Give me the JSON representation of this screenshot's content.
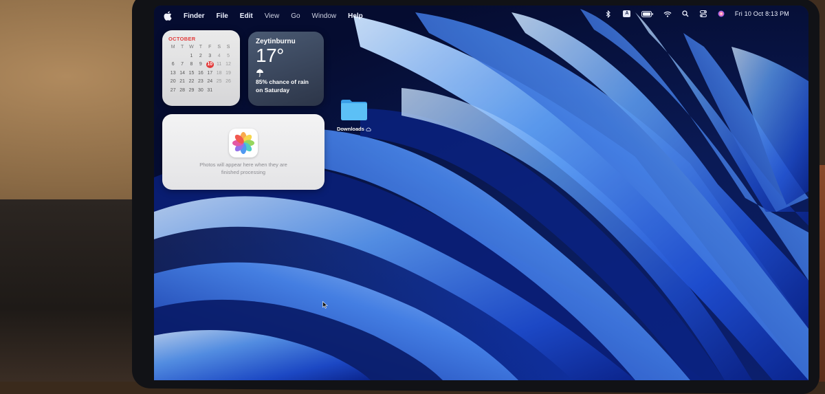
{
  "menubar": {
    "app_name": "Finder",
    "menus": [
      "File",
      "Edit",
      "View",
      "Go",
      "Window",
      "Help"
    ],
    "status_icons": [
      "bluetooth-icon",
      "input-source-icon",
      "battery-icon",
      "wifi-icon",
      "spotlight-search-icon",
      "control-center-icon",
      "siri-icon"
    ],
    "input_source": "A",
    "clock": "Fri 10 Oct  8:13 PM"
  },
  "calendar_widget": {
    "month": "OCTOBER",
    "weekdays": [
      "M",
      "T",
      "W",
      "T",
      "F",
      "S",
      "S"
    ],
    "weeks": [
      [
        "",
        "",
        "1",
        "2",
        "3",
        "4",
        "5"
      ],
      [
        "6",
        "7",
        "8",
        "9",
        "10",
        "11",
        "12"
      ],
      [
        "13",
        "14",
        "15",
        "16",
        "17",
        "18",
        "19"
      ],
      [
        "20",
        "21",
        "22",
        "23",
        "24",
        "25",
        "26"
      ],
      [
        "27",
        "28",
        "29",
        "30",
        "31",
        "",
        ""
      ]
    ],
    "today": "10",
    "accent_color": "#e23b3b"
  },
  "weather_widget": {
    "city": "Zeytinburnu",
    "temperature": "17°",
    "condition_icon": "umbrella-icon",
    "condition_line1": "85% chance of rain",
    "condition_line2": "on Saturday"
  },
  "photos_widget": {
    "icon": "photos-app-icon",
    "message_line1": "Photos will appear here when they are",
    "message_line2": "finished processing"
  },
  "desktop_items": [
    {
      "label": "Downloads",
      "icon": "folder-icon",
      "cloud_status": "icloud-icon"
    }
  ],
  "colors": {
    "wallpaper_deep": "#0a1a55",
    "wallpaper_mid": "#1d4bd0",
    "wallpaper_light": "#8ec2ff",
    "folder_blue": "#4fb3f2"
  }
}
